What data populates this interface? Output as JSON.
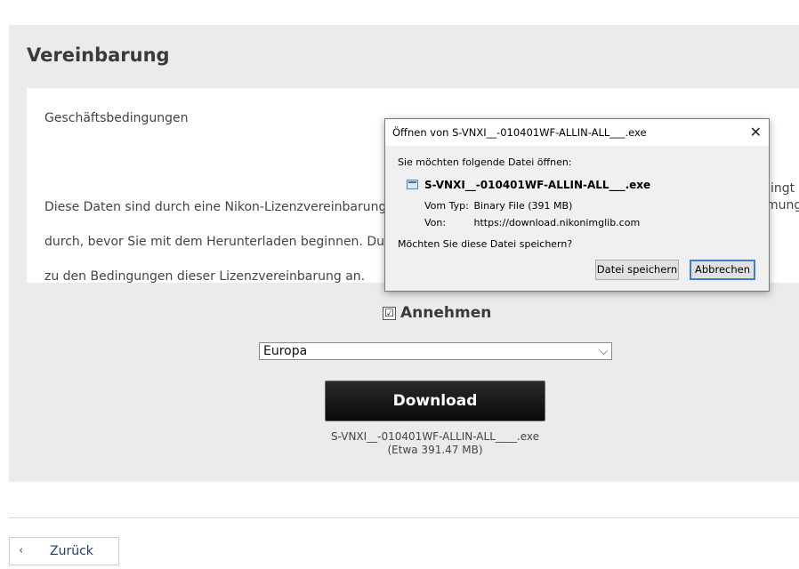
{
  "page": {
    "section_title": "Vereinbarung",
    "terms": {
      "heading": "Geschäftsbedingungen",
      "body": "Diese Daten sind durch eine Nikon-Lizenzvereinbarung geschützt. Bitte lesen Sie die Lizenzvereinbarung sorgfältig durch, bevor Sie mit dem Herunterladen beginnen. Durch Klicken auf „Annehmen“ erklären Sie Ihre Zustimmung\nzu den Bedingungen dieser Lizenzvereinbarung an.",
      "visible_lines": [
        "Diese Daten sind durch eine Nikon-Lizenzvereinbarung",
        "durch, bevor Sie mit dem Herunterladen beginnen. Du",
        "zu den Bedingungen dieser Lizenzvereinbarung an."
      ],
      "right_fragments": [
        "ingt",
        "mung"
      ]
    },
    "accept": {
      "checked": true,
      "check_glyph": "☑",
      "label": "Annehmen"
    },
    "region_select": {
      "value": "Europa",
      "chevron": "⌵"
    },
    "download_button": {
      "label": "Download"
    },
    "file": {
      "name": "S-VNXI__-010401WF-ALLIN-ALL____.exe",
      "size": "(Etwa 391.47 MB)"
    },
    "back_button": {
      "chevron": "‹",
      "label": "Zurück"
    }
  },
  "dialog": {
    "title": "Öffnen von S-VNXI__-010401WF-ALLIN-ALL___.exe",
    "close_glyph": "✕",
    "prompt": "Sie möchten folgende Datei öffnen:",
    "filename": "S-VNXI__-010401WF-ALLIN-ALL___.exe",
    "type_label": "Vom Typ:",
    "type_value": "Binary File (391 MB)",
    "from_label": "Von:",
    "from_value": "https://download.nikonimglib.com",
    "question": "Möchten Sie diese Datei speichern?",
    "save_button": "Datei speichern",
    "cancel_button": "Abbrechen"
  }
}
